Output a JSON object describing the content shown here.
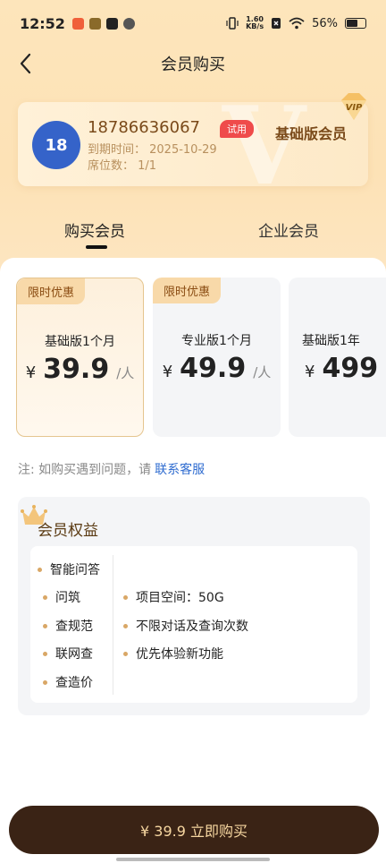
{
  "status_bar": {
    "time": "12:52",
    "net_speed_value": "1.60",
    "net_speed_unit": "KB/s",
    "battery": "56%"
  },
  "header": {
    "title": "会员购买"
  },
  "member": {
    "avatar_text": "18",
    "phone": "18786636067",
    "trial_badge": "试用",
    "expire": "到期时间： 2025-10-29",
    "seats": "席位数： 1/1",
    "level": "基础版会员",
    "vip_badge": "VIP",
    "bg_letter": "V"
  },
  "tabs": [
    {
      "label": "购买会员",
      "active": true
    },
    {
      "label": "企业会员",
      "active": false
    }
  ],
  "plans": [
    {
      "tag": "限时优惠",
      "name": "基础版1个月",
      "currency": "¥",
      "price": "39.9",
      "unit": "/人",
      "selected": true
    },
    {
      "tag": "限时优惠",
      "name": "专业版1个月",
      "currency": "¥",
      "price": "49.9",
      "unit": "/人",
      "selected": false
    },
    {
      "name": "基础版1年",
      "currency": "¥",
      "price": "499",
      "selected": false
    }
  ],
  "note": {
    "text": "注: 如购买遇到问题，请",
    "link": "联系客服"
  },
  "benefits": {
    "title": "会员权益",
    "left_items": [
      "智能问答",
      "问筑",
      "查规范",
      "联网查",
      "查造价"
    ],
    "right_items": [
      "项目空间：50G",
      "不限对话及查询次数",
      "优先体验新功能"
    ]
  },
  "buy_button": {
    "label": "¥ 39.9  立即购买"
  },
  "colors": {
    "accent": "#3a2315",
    "link": "#2f6cd0",
    "badge": "#ef4b4b"
  }
}
